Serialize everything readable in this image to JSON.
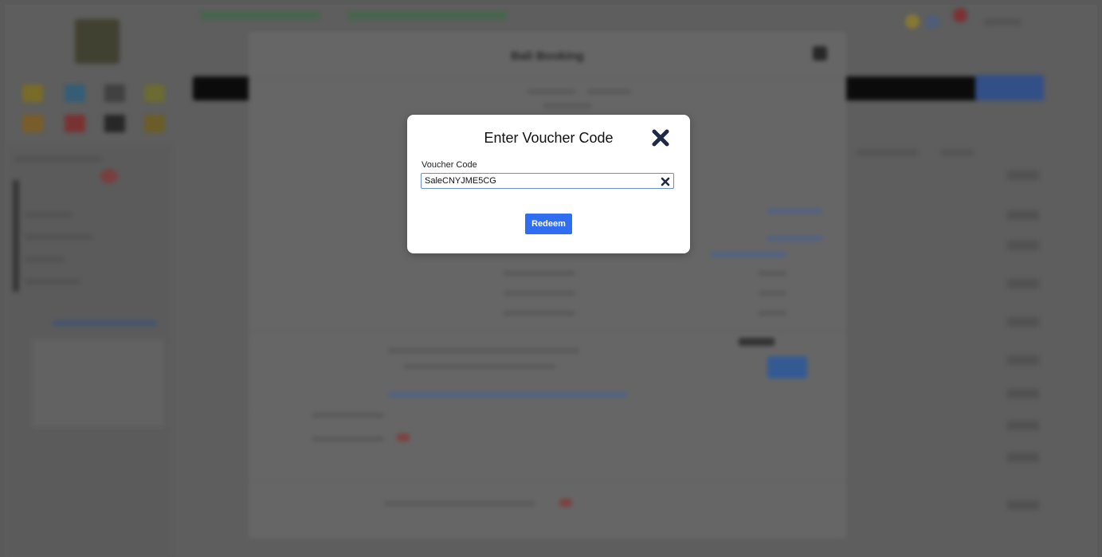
{
  "background": {
    "booking_modal_title": "Bali Booking"
  },
  "voucher_dialog": {
    "title": "Enter Voucher Code",
    "field_label": "Voucher Code",
    "field_value": "SaleCNYJME5CG",
    "redeem_label": "Redeem",
    "close_icon": "close-x-icon",
    "clear_icon": "clear-x-icon"
  },
  "colors": {
    "accent_blue": "#2f6ef0",
    "input_border": "#6a8cc8",
    "close_icon": "#1f2a44"
  }
}
